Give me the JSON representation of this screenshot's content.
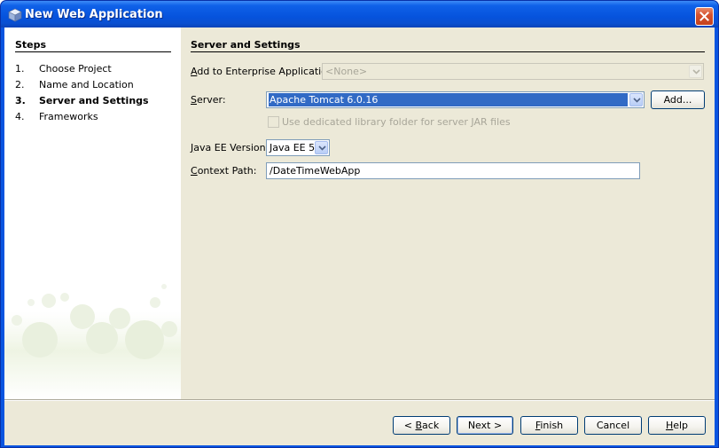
{
  "window": {
    "title": "New Web Application",
    "icon": "netbeans-cube-icon"
  },
  "steps": {
    "heading": "Steps",
    "items": [
      {
        "num": "1.",
        "label": "Choose Project",
        "current": false
      },
      {
        "num": "2.",
        "label": "Name and Location",
        "current": false
      },
      {
        "num": "3.",
        "label": "Server and Settings",
        "current": true
      },
      {
        "num": "4.",
        "label": "Frameworks",
        "current": false
      }
    ]
  },
  "panel": {
    "heading": "Server and Settings",
    "enterprise": {
      "label_pre": "",
      "label_mn": "A",
      "label_post": "dd to Enterprise Application:",
      "value": "<None>",
      "disabled": true
    },
    "server": {
      "label_pre": "",
      "label_mn": "S",
      "label_post": "erver:",
      "value": "Apache Tomcat 6.0.16",
      "add_label": "Add..."
    },
    "dedicated_lib": {
      "label": "Use dedicated library folder for server JAR files",
      "checked": false,
      "disabled": true
    },
    "javaee": {
      "label_pre": "",
      "label_mn": "J",
      "label_post": "ava EE Version:",
      "value": "Java EE 5"
    },
    "context": {
      "label_pre": "",
      "label_mn": "C",
      "label_post": "ontext Path:",
      "value": "/DateTimeWebApp"
    }
  },
  "buttons": {
    "back": {
      "pre": "< ",
      "mn": "B",
      "post": "ack"
    },
    "next": {
      "label": "Next >"
    },
    "finish": {
      "pre": "",
      "mn": "F",
      "post": "inish"
    },
    "cancel": {
      "label": "Cancel"
    },
    "help": {
      "pre": "",
      "mn": "H",
      "post": "elp"
    }
  },
  "colors": {
    "titlebar": "#0653dd",
    "selection": "#316ac5",
    "panel_bg": "#ece9d8"
  }
}
